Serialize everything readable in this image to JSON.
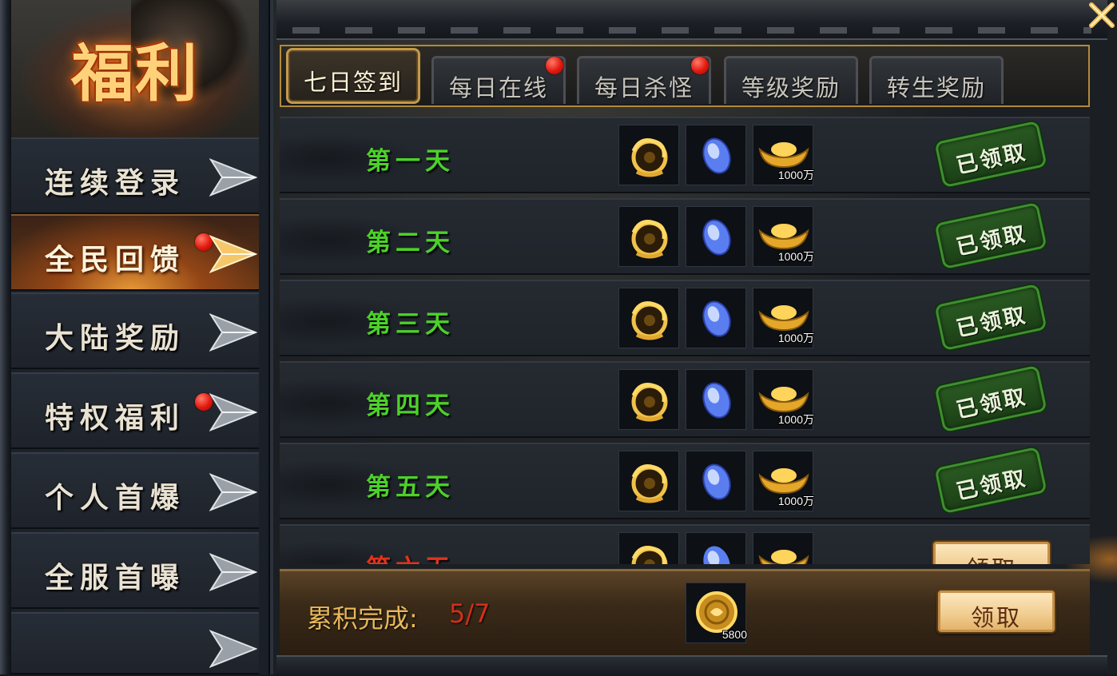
{
  "logo": {
    "text": "福利"
  },
  "sidebar": {
    "items": [
      {
        "label": "连续登录",
        "active": false,
        "badge": false
      },
      {
        "label": "全民回馈",
        "active": true,
        "badge": true
      },
      {
        "label": "大陆奖励",
        "active": false,
        "badge": false
      },
      {
        "label": "特权福利",
        "active": false,
        "badge": true
      },
      {
        "label": "个人首爆",
        "active": false,
        "badge": false
      },
      {
        "label": "全服首曝",
        "active": false,
        "badge": false
      }
    ]
  },
  "tabs": [
    {
      "label": "七日签到",
      "active": true,
      "badge": false
    },
    {
      "label": "每日在线",
      "active": false,
      "badge": true
    },
    {
      "label": "每日杀怪",
      "active": false,
      "badge": true
    },
    {
      "label": "等级奖励",
      "active": false,
      "badge": false
    },
    {
      "label": "转生奖励",
      "active": false,
      "badge": false
    }
  ],
  "rows": [
    {
      "day": "第一天",
      "gold_qty": "1000万",
      "status": "已领取"
    },
    {
      "day": "第二天",
      "gold_qty": "1000万",
      "status": "已领取"
    },
    {
      "day": "第三天",
      "gold_qty": "1000万",
      "status": "已领取"
    },
    {
      "day": "第四天",
      "gold_qty": "1000万",
      "status": "已领取"
    },
    {
      "day": "第五天",
      "gold_qty": "1000万",
      "status": "已领取"
    },
    {
      "day": "第六天",
      "gold_qty": "",
      "status": "领取"
    }
  ],
  "cumulative": {
    "label": "累积完成:",
    "value": "5/7",
    "reward_qty": "5800",
    "button": "领取"
  },
  "colors": {
    "claimed_day": "#4cd12a",
    "pending_day": "#e0341e",
    "accent_gold": "#e8b75a",
    "badge_red": "#e3180e"
  },
  "icons": {
    "reward_1": "gold-dragon-medal-icon",
    "reward_2": "blue-gem-icon",
    "reward_3": "gold-ingot-icon",
    "cumulative_reward": "gold-coin-icon"
  }
}
